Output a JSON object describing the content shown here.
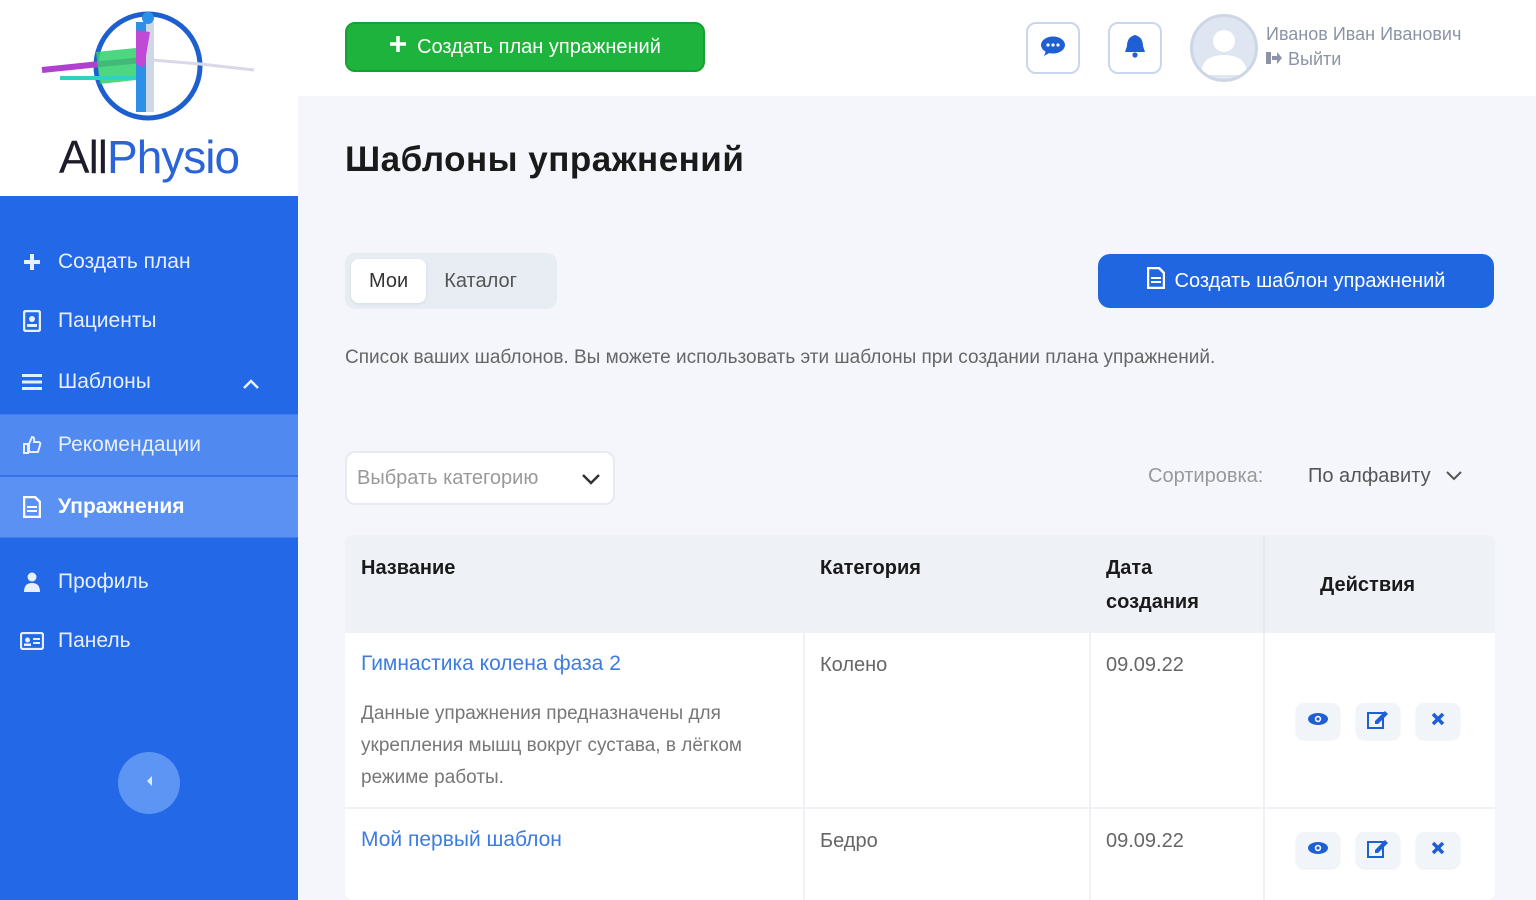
{
  "brand": {
    "part1": "All",
    "part2": "Physio"
  },
  "sidebar": {
    "items": [
      {
        "label": "Создать план",
        "icon": "plus-icon"
      },
      {
        "label": "Пациенты",
        "icon": "id-badge-icon"
      },
      {
        "label": "Шаблоны",
        "icon": "list-icon"
      },
      {
        "label": "Рекомендации",
        "icon": "thumbs-up-icon"
      },
      {
        "label": "Упражнения",
        "icon": "document-icon"
      },
      {
        "label": "Профиль",
        "icon": "user-icon"
      },
      {
        "label": "Панель",
        "icon": "id-card-icon"
      }
    ]
  },
  "topbar": {
    "create_plan_label": "Создать план упражнений",
    "user_name": "Иванов Иван Иванович",
    "logout_label": "Выйти"
  },
  "main": {
    "title": "Шаблоны упражнений",
    "tabs": [
      {
        "label": "Мои"
      },
      {
        "label": "Каталог"
      }
    ],
    "create_template_label": "Создать шаблон упражнений",
    "description": "Список ваших шаблонов. Вы можете использовать эти шаблоны при создании плана упражнений.",
    "category_placeholder": "Выбрать категорию",
    "sort_label": "Сортировка:",
    "sort_value": "По алфавиту"
  },
  "table": {
    "headers": {
      "name": "Название",
      "category": "Категория",
      "date_line1": "Дата",
      "date_line2": "создания",
      "actions": "Действия"
    },
    "rows": [
      {
        "name": "Гимнастика колена фаза 2",
        "description": "Данные упражнения предназначены для укрепления мышц вокруг сустава, в лёгком режиме работы.",
        "category": "Колено",
        "date": "09.09.22"
      },
      {
        "name": "Мой первый шаблон",
        "category": "Бедро",
        "date": "09.09.22"
      }
    ]
  },
  "colors": {
    "primary": "#2368e6",
    "success": "#1eb33c",
    "link": "#3c7be0"
  }
}
